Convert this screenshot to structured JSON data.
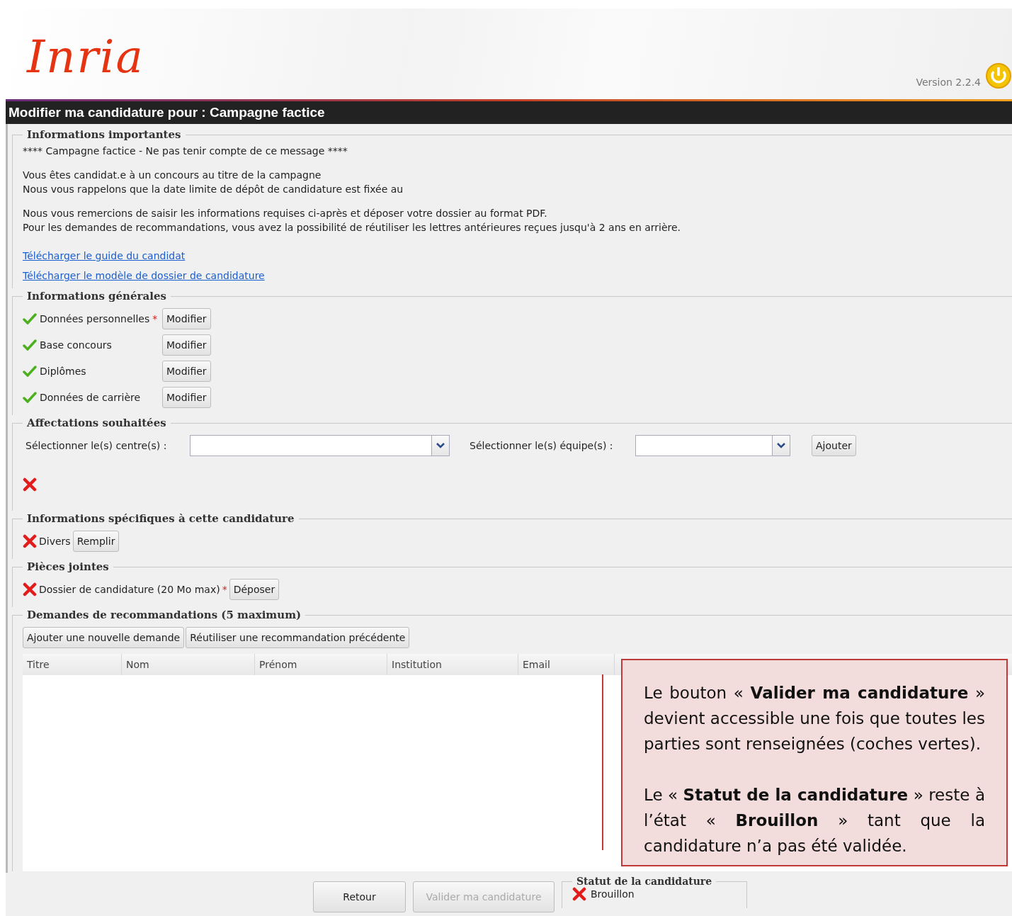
{
  "header": {
    "logo": "Inria",
    "version": "Version 2.2.4"
  },
  "title": "Modifier ma candidature pour : Campagne factice",
  "important": {
    "legend": "Informations importantes",
    "paragraphs": [
      [
        "**** Campagne factice - Ne pas tenir compte de ce message ****"
      ],
      [
        "Vous êtes candidat.e à un concours au titre de la campagne",
        "Nous vous rappelons que la date limite de dépôt de candidature est fixée au"
      ],
      [
        "Nous vous remercions de saisir les informations requises ci-après et déposer votre dossier au format PDF.",
        "Pour les demandes de recommandations, vous avez la possibilité de réutiliser les lettres antérieures reçues jusqu'à 2 ans en arrière."
      ]
    ],
    "links": [
      "Télécharger le guide du candidat",
      "Télécharger le modèle de dossier de candidature"
    ]
  },
  "general": {
    "legend": "Informations générales",
    "items": [
      {
        "label": "Données personnelles",
        "complete": true,
        "required_mark": "*",
        "button": "Modifier"
      },
      {
        "label": "Base concours",
        "complete": true,
        "button": "Modifier"
      },
      {
        "label": "Diplômes",
        "complete": true,
        "button": "Modifier"
      },
      {
        "label": "Données de carrière",
        "complete": true,
        "button": "Modifier"
      }
    ]
  },
  "assignments": {
    "legend": "Affectations souhaitées",
    "centre_label": "Sélectionner le(s) centre(s) :",
    "team_label": "Sélectionner le(s) équipe(s) :",
    "button": "Ajouter",
    "complete": false
  },
  "specific": {
    "legend": "Informations spécifiques à cette candidature",
    "items": [
      {
        "label": "Divers",
        "complete": false,
        "button": "Remplir"
      }
    ]
  },
  "attachments": {
    "legend": "Pièces jointes",
    "items": [
      {
        "label": "Dossier de candidature (20 Mo max)",
        "complete": false,
        "required_mark": "*",
        "button": "Déposer"
      }
    ]
  },
  "recommendations": {
    "legend": "Demandes de recommandations (5 maximum)",
    "buttons": [
      "Ajouter une nouvelle demande",
      "Réutiliser une recommandation précédente"
    ],
    "table": {
      "columns": [
        "Titre",
        "Nom",
        "Prénom",
        "Institution",
        "Email"
      ]
    }
  },
  "footer": {
    "buttons": [
      {
        "label": "Retour",
        "disabled": false
      },
      {
        "label": "Valider ma candidature",
        "disabled": true
      }
    ],
    "status": {
      "legend": "Statut de la candidature",
      "label": "Brouillon",
      "complete": false
    }
  },
  "callout": {
    "paragraphs": [
      "Le bouton « **Valider ma candidature** » devient accessible une fois que toutes les parties sont renseignées (coches vertes).",
      "Le « **Statut de la candidature** » reste à l’état « **Brouillon** » tant que la candidature n’a pas été validée."
    ]
  }
}
